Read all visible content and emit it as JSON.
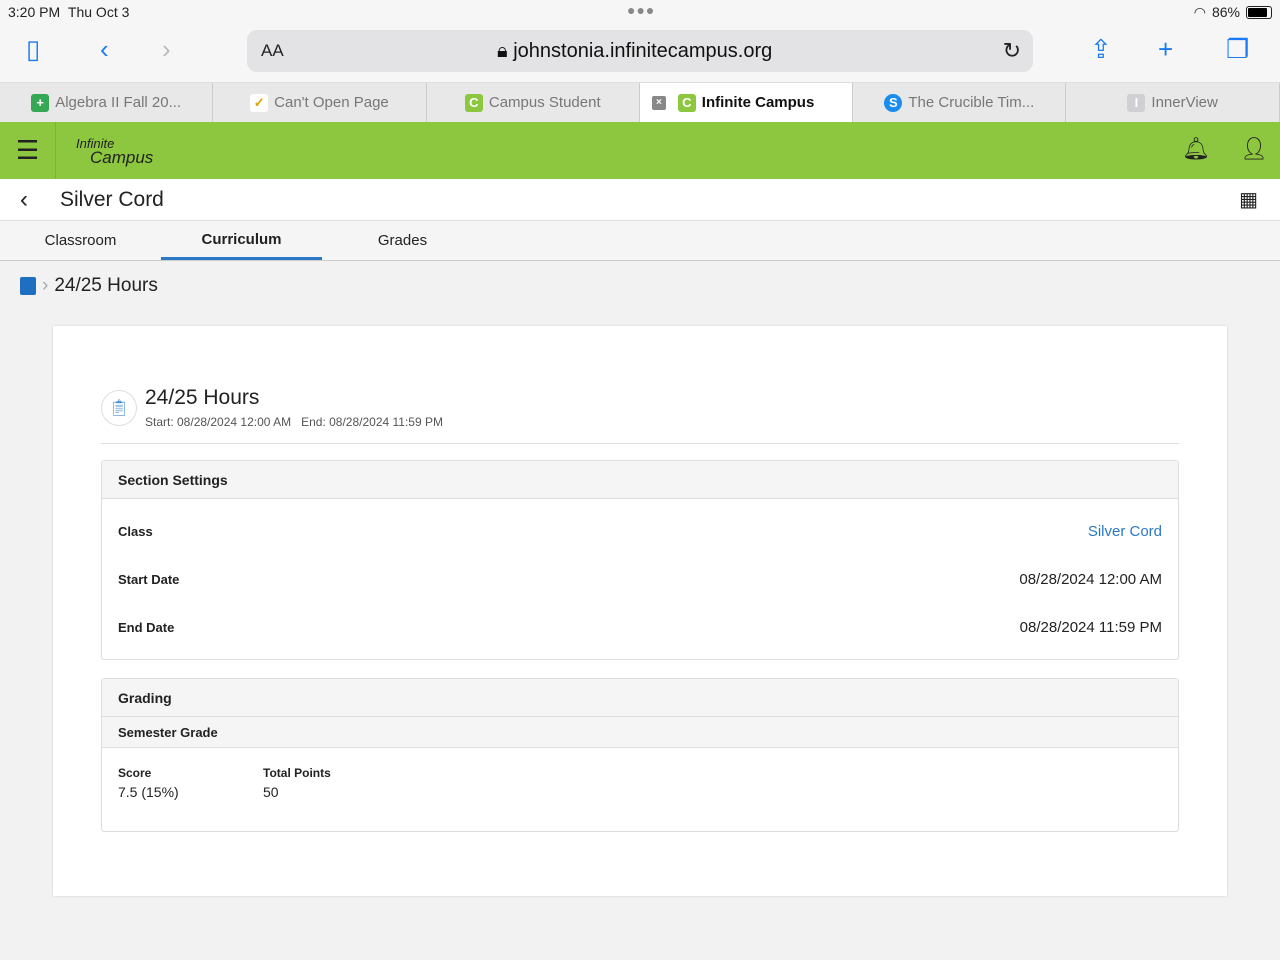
{
  "status": {
    "time": "3:20 PM",
    "date": "Thu Oct 3",
    "battery": "86%",
    "battery_level": 0.86
  },
  "browser": {
    "aa": "AA",
    "url": "johnstonia.infinitecampus.org",
    "tabs": [
      {
        "label": "Algebra II Fall 20...",
        "icon": "+",
        "color": "#34a853"
      },
      {
        "label": "Can't Open Page",
        "icon": "✓",
        "color": "#ffffff"
      },
      {
        "label": "Campus Student",
        "icon": "C",
        "color": "#8dc63f"
      },
      {
        "label": "Infinite Campus",
        "icon": "C",
        "color": "#8dc63f"
      },
      {
        "label": "The Crucible Tim...",
        "icon": "S",
        "color": "#1a8cf0"
      },
      {
        "label": "InnerView",
        "icon": "I",
        "color": "#cfcfd4"
      }
    ]
  },
  "app": {
    "logo_top": "Infinite",
    "logo_bottom": "Campus",
    "page_title": "Silver Cord",
    "subtabs": [
      "Classroom",
      "Curriculum",
      "Grades"
    ],
    "breadcrumb": "24/25 Hours"
  },
  "assignment": {
    "title": "24/25 Hours",
    "dates": "Start: 08/28/2024 12:00 AM   End: 08/28/2024 11:59 PM",
    "section_settings": "Section Settings",
    "rows": [
      {
        "label": "Class",
        "value": "Silver Cord"
      },
      {
        "label": "Start Date",
        "value": "08/28/2024 12:00 AM"
      },
      {
        "label": "End Date",
        "value": "08/28/2024 11:59 PM"
      }
    ],
    "grading": "Grading",
    "semester": "Semester Grade",
    "score_label": "Score",
    "score": "7.5 (15%)",
    "total_label": "Total Points",
    "total": "50"
  }
}
